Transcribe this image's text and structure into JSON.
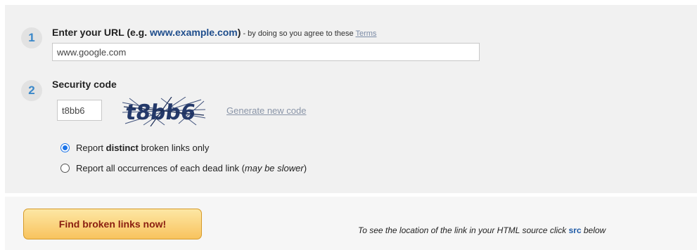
{
  "step1": {
    "number": "1",
    "title_prefix": "Enter your URL (e.g. ",
    "title_example": "www.example.com",
    "title_suffix": ")",
    "agree_text": " - by doing so you agree to these ",
    "terms_link": "Terms",
    "url_value": "www.google.com"
  },
  "step2": {
    "number": "2",
    "title": "Security code",
    "code_value": "t8bb6",
    "captcha_text": "t8bb6",
    "regenerate_link": "Generate new code"
  },
  "options": {
    "distinct": {
      "prefix": "Report ",
      "bold": "distinct",
      "suffix": " broken links only",
      "checked": true
    },
    "all": {
      "prefix": "Report all occurrences of each dead link (",
      "italic": "may be slower",
      "suffix": ")",
      "checked": false
    }
  },
  "actions": {
    "find_button": "Find broken links now!",
    "hint_prefix": "To see the location of the link in your HTML source click ",
    "hint_src": "src",
    "hint_suffix": " below"
  },
  "colors": {
    "panel_bg": "#f1f1f1",
    "step_number": "#3b88c9",
    "button_text": "#8a1e10",
    "button_gradient_top": "#fde7a4",
    "button_gradient_bottom": "#f8c35e",
    "radio_checked": "#1a73e8"
  }
}
